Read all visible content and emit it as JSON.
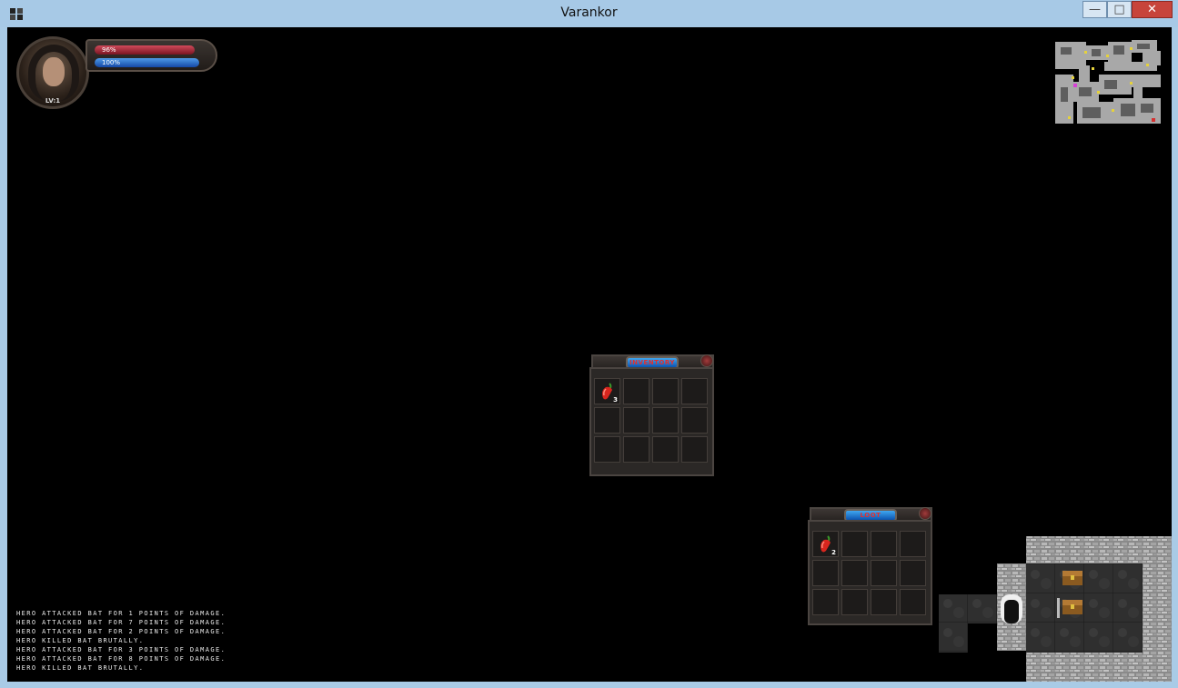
{
  "window": {
    "title": "Varankor",
    "minimize": "—",
    "maximize": "□",
    "close": "✕"
  },
  "hud": {
    "level_label": "LV:1",
    "health_label": "96%",
    "health_fraction": 0.96,
    "mana_label": "100%",
    "mana_fraction": 1.0
  },
  "inventory": {
    "title": "INVENTORY",
    "columns": 4,
    "slots": [
      {
        "item": "chili-pepper-icon",
        "qty": "3"
      },
      {},
      {},
      {},
      {},
      {},
      {},
      {},
      {},
      {},
      {},
      {}
    ]
  },
  "loot": {
    "title": "LOOT",
    "columns": 4,
    "slots": [
      {
        "item": "chili-pepper-icon",
        "qty": "2"
      },
      {},
      {},
      {},
      {},
      {},
      {},
      {},
      {},
      {},
      {},
      {}
    ]
  },
  "log": [
    "HERO ATTACKED BAT FOR 1 POINTS OF DAMAGE.",
    "HERO ATTACKED BAT FOR 7 POINTS OF DAMAGE.",
    "HERO ATTACKED BAT FOR 2 POINTS OF DAMAGE.",
    "HERO KILLED BAT BRUTALLY.",
    "HERO ATTACKED BAT FOR 3 POINTS OF DAMAGE.",
    "HERO ATTACKED BAT FOR 8 POINTS OF DAMAGE.",
    "HERO KILLED BAT BRUTALLY."
  ],
  "colors": {
    "health": "#c0283a",
    "mana": "#2a74d6",
    "plaque": "#1e86de",
    "background": "#000000"
  }
}
